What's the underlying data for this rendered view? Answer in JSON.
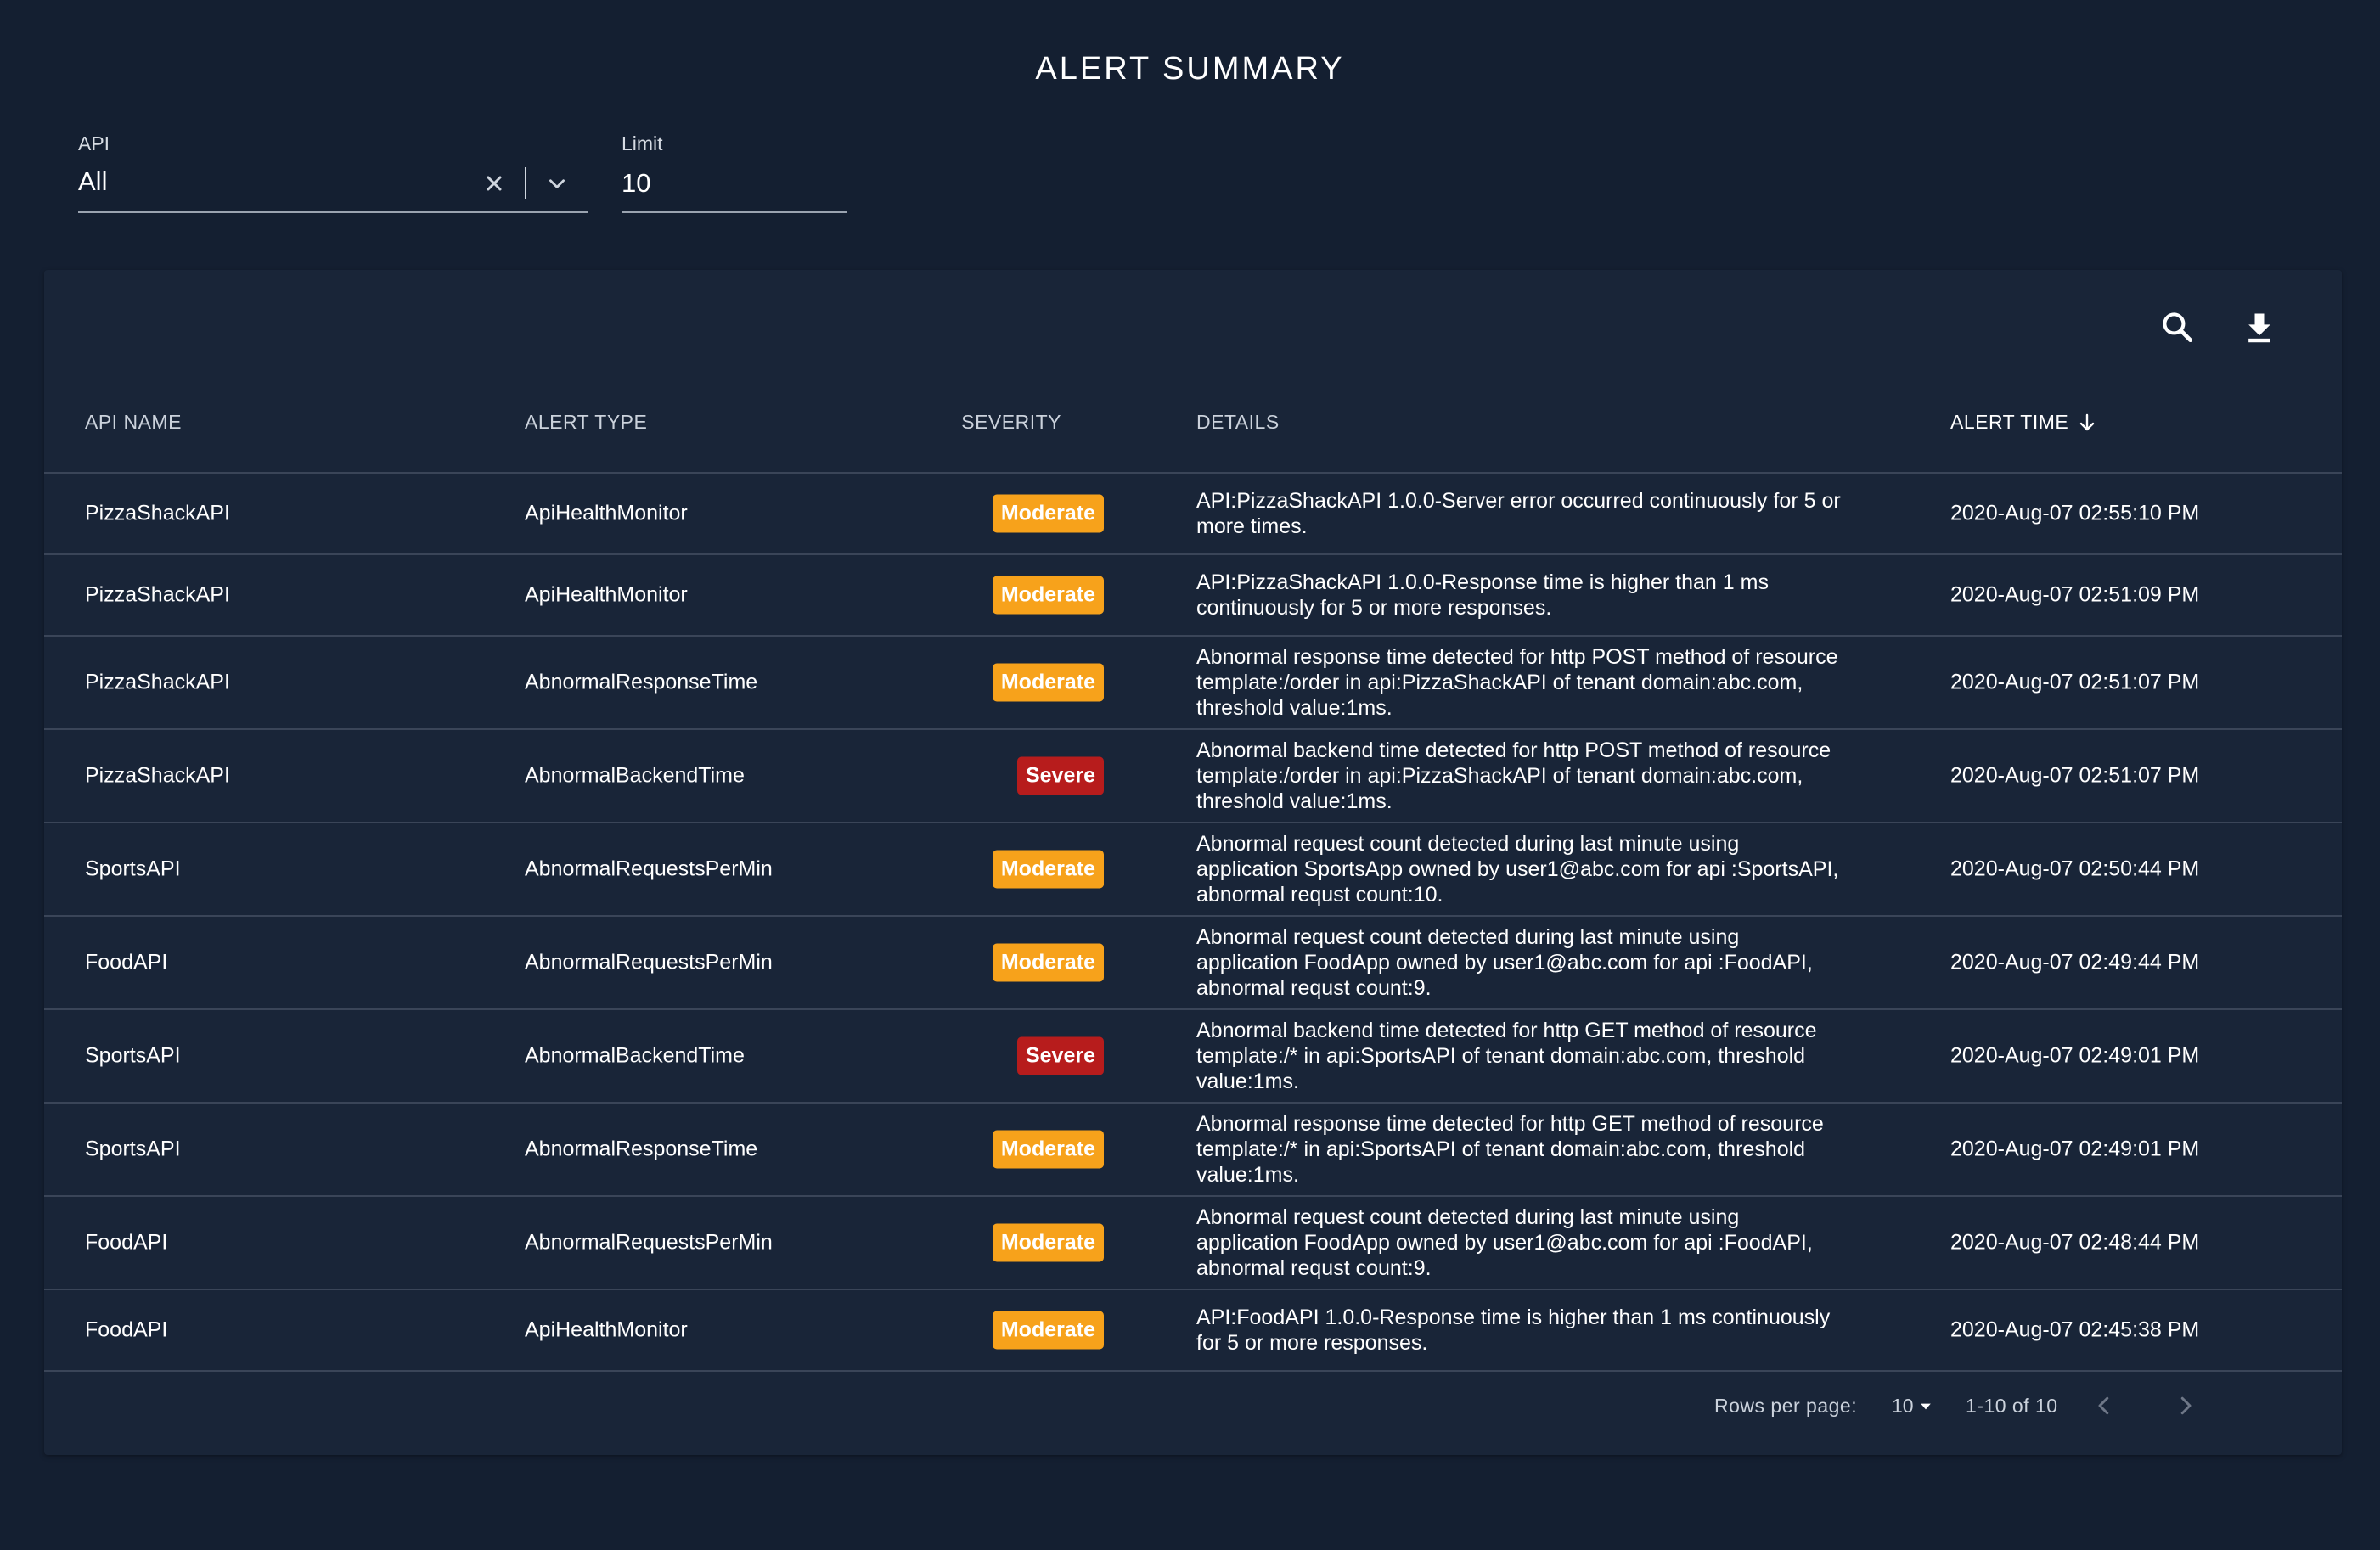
{
  "page": {
    "title": "ALERT SUMMARY"
  },
  "filters": {
    "api": {
      "label": "API",
      "value": "All"
    },
    "limit": {
      "label": "Limit",
      "value": "10"
    }
  },
  "toolbar": {
    "search_icon": "search-icon",
    "download_icon": "download-icon"
  },
  "table": {
    "headers": {
      "api_name": "API NAME",
      "alert_type": "ALERT TYPE",
      "severity": "SEVERITY",
      "details": "DETAILS",
      "alert_time": "ALERT TIME"
    },
    "sort": {
      "column": "alert_time",
      "direction": "descending"
    },
    "rows": [
      {
        "api_name": "PizzaShackAPI",
        "alert_type": "ApiHealthMonitor",
        "severity": "Moderate",
        "details": "API:PizzaShackAPI 1.0.0-Server error occurred continuously for 5 or more times.",
        "alert_time": "2020-Aug-07 02:55:10 PM"
      },
      {
        "api_name": "PizzaShackAPI",
        "alert_type": "ApiHealthMonitor",
        "severity": "Moderate",
        "details": "API:PizzaShackAPI 1.0.0-Response time is higher than 1 ms continuously for 5 or more responses.",
        "alert_time": "2020-Aug-07 02:51:09 PM"
      },
      {
        "api_name": "PizzaShackAPI",
        "alert_type": "AbnormalResponseTime",
        "severity": "Moderate",
        "details": "Abnormal response time detected for http POST method of resource template:/order in api:PizzaShackAPI of tenant domain:abc.com, threshold value:1ms.",
        "alert_time": "2020-Aug-07 02:51:07 PM"
      },
      {
        "api_name": "PizzaShackAPI",
        "alert_type": "AbnormalBackendTime",
        "severity": "Severe",
        "details": "Abnormal backend time detected for http POST method of resource template:/order in api:PizzaShackAPI of tenant domain:abc.com, threshold value:1ms.",
        "alert_time": "2020-Aug-07 02:51:07 PM"
      },
      {
        "api_name": "SportsAPI",
        "alert_type": "AbnormalRequestsPerMin",
        "severity": "Moderate",
        "details": "Abnormal request count detected during last minute using application SportsApp owned by user1@abc.com for api :SportsAPI, abnormal requst count:10.",
        "alert_time": "2020-Aug-07 02:50:44 PM"
      },
      {
        "api_name": "FoodAPI",
        "alert_type": "AbnormalRequestsPerMin",
        "severity": "Moderate",
        "details": "Abnormal request count detected during last minute using application FoodApp owned by user1@abc.com for api :FoodAPI, abnormal requst count:9.",
        "alert_time": "2020-Aug-07 02:49:44 PM"
      },
      {
        "api_name": "SportsAPI",
        "alert_type": "AbnormalBackendTime",
        "severity": "Severe",
        "details": "Abnormal backend time detected for http GET method of resource template:/* in api:SportsAPI of tenant domain:abc.com, threshold value:1ms.",
        "alert_time": "2020-Aug-07 02:49:01 PM"
      },
      {
        "api_name": "SportsAPI",
        "alert_type": "AbnormalResponseTime",
        "severity": "Moderate",
        "details": "Abnormal response time detected for http GET method of resource template:/* in api:SportsAPI of tenant domain:abc.com, threshold value:1ms.",
        "alert_time": "2020-Aug-07 02:49:01 PM"
      },
      {
        "api_name": "FoodAPI",
        "alert_type": "AbnormalRequestsPerMin",
        "severity": "Moderate",
        "details": "Abnormal request count detected during last minute using application FoodApp owned by user1@abc.com for api :FoodAPI, abnormal requst count:9.",
        "alert_time": "2020-Aug-07 02:48:44 PM"
      },
      {
        "api_name": "FoodAPI",
        "alert_type": "ApiHealthMonitor",
        "severity": "Moderate",
        "details": "API:FoodAPI 1.0.0-Response time is higher than 1 ms continuously for 5 or more responses.",
        "alert_time": "2020-Aug-07 02:45:38 PM"
      }
    ]
  },
  "severity_colors": {
    "Moderate": "#f7a21b",
    "Severe": "#b71c1c"
  },
  "pagination": {
    "rows_per_page_label": "Rows per page:",
    "rows_per_page_value": "10",
    "range": "1-10 of 10",
    "prev_icon": "chevron-left-icon",
    "next_icon": "chevron-right-icon"
  }
}
